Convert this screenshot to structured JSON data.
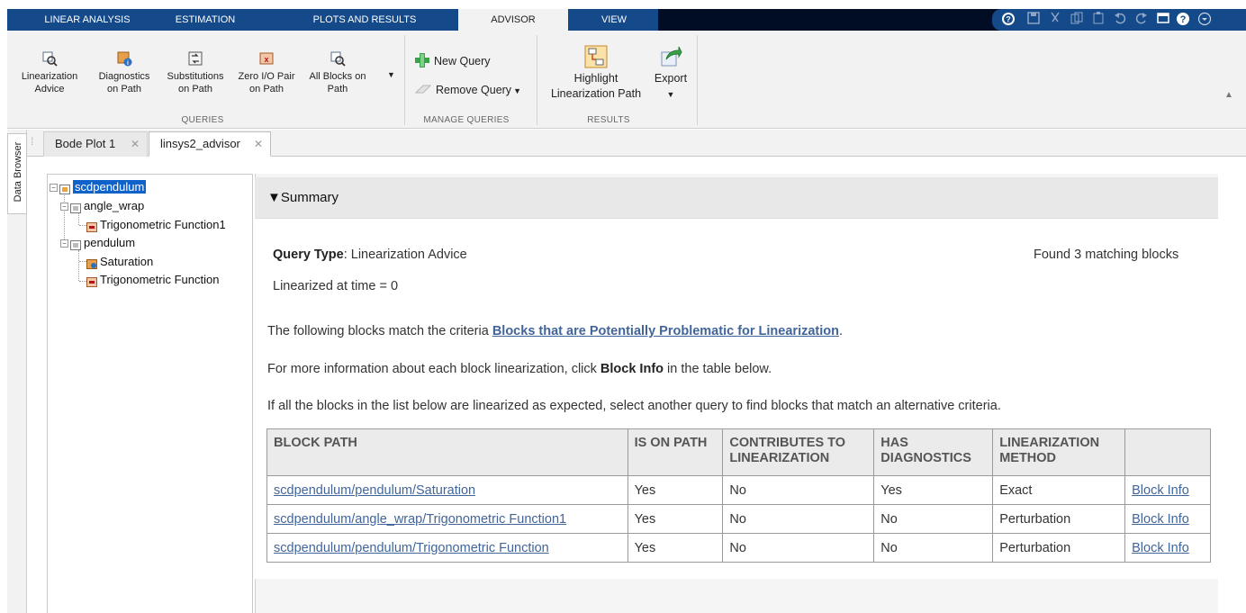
{
  "toolstrip": {
    "tabs": [
      {
        "label": "LINEAR ANALYSIS"
      },
      {
        "label": "ESTIMATION"
      },
      {
        "label": "PLOTS AND RESULTS"
      },
      {
        "label": "ADVISOR"
      },
      {
        "label": "VIEW"
      }
    ],
    "active_tab": "ADVISOR",
    "quick_access_icons": [
      "help-circle-icon",
      "save-icon",
      "cut-icon",
      "copy-icon",
      "paste-icon",
      "undo-icon",
      "redo-icon",
      "window-icon",
      "help-icon",
      "expand-icon"
    ]
  },
  "ribbon": {
    "queries": {
      "group_label": "QUERIES",
      "buttons": [
        {
          "line1": "Linearization",
          "line2": "Advice",
          "icon": "linearization-advice-icon"
        },
        {
          "line1": "Diagnostics",
          "line2": "on Path",
          "icon": "diagnostics-icon"
        },
        {
          "line1": "Substitutions",
          "line2": "on Path",
          "icon": "substitutions-icon"
        },
        {
          "line1": "Zero I/O Pair",
          "line2": "on Path",
          "icon": "zero-io-pair-icon"
        },
        {
          "line1": "All Blocks on",
          "line2": "Path",
          "icon": "all-blocks-icon"
        }
      ]
    },
    "manage_queries": {
      "group_label": "MANAGE QUERIES",
      "new_query": "New Query",
      "remove_query": "Remove Query"
    },
    "results": {
      "group_label": "RESULTS",
      "highlight_line1": "Highlight",
      "highlight_line2": "Linearization Path",
      "export": "Export"
    }
  },
  "side": {
    "data_browser": "Data Browser"
  },
  "doc_tabs": [
    {
      "label": "Bode Plot 1",
      "active": false
    },
    {
      "label": "linsys2_advisor",
      "active": true
    }
  ],
  "tree": {
    "root": "scdpendulum",
    "children": [
      {
        "label": "angle_wrap",
        "children": [
          "Trigonometric Function1"
        ]
      },
      {
        "label": "pendulum",
        "children": [
          "Saturation",
          "Trigonometric Function"
        ]
      }
    ]
  },
  "report": {
    "summary_label": "▼Summary",
    "query_type_label": "Query Type",
    "query_type_value": ": Linearization Advice",
    "found_text": "Found 3 matching blocks",
    "linearized_at": "Linearized at time = 0",
    "criteria_prefix": "The following blocks match the criteria ",
    "criteria_link": "Blocks that are Potentially Problematic for Linearization",
    "criteria_suffix": ".",
    "info_prefix": "For more information about each block linearization, click ",
    "info_bold": "Block Info",
    "info_suffix": " in the table below.",
    "alt_text": "If all the blocks in the list below are linearized as expected, select another query to find blocks that match an alternative criteria.",
    "table": {
      "headers": [
        "BLOCK PATH",
        "IS ON PATH",
        "CONTRIBUTES TO LINEARIZATION",
        "HAS DIAGNOSTICS",
        "LINEARIZATION METHOD",
        ""
      ],
      "rows": [
        {
          "path": "scdpendulum/pendulum/Saturation",
          "on_path": "Yes",
          "contributes": "No",
          "diagnostics": "Yes",
          "method": "Exact",
          "info": "Block Info"
        },
        {
          "path": "scdpendulum/angle_wrap/Trigonometric Function1",
          "on_path": "Yes",
          "contributes": "No",
          "diagnostics": "No",
          "method": "Perturbation",
          "info": "Block Info"
        },
        {
          "path": "scdpendulum/pendulum/Trigonometric Function",
          "on_path": "Yes",
          "contributes": "No",
          "diagnostics": "No",
          "method": "Perturbation",
          "info": "Block Info"
        }
      ]
    }
  },
  "colors": {
    "tab_bar": "#144a8a",
    "tab_bar_dark": "#000d24",
    "link": "#41659a",
    "selection": "#0e62c9"
  }
}
